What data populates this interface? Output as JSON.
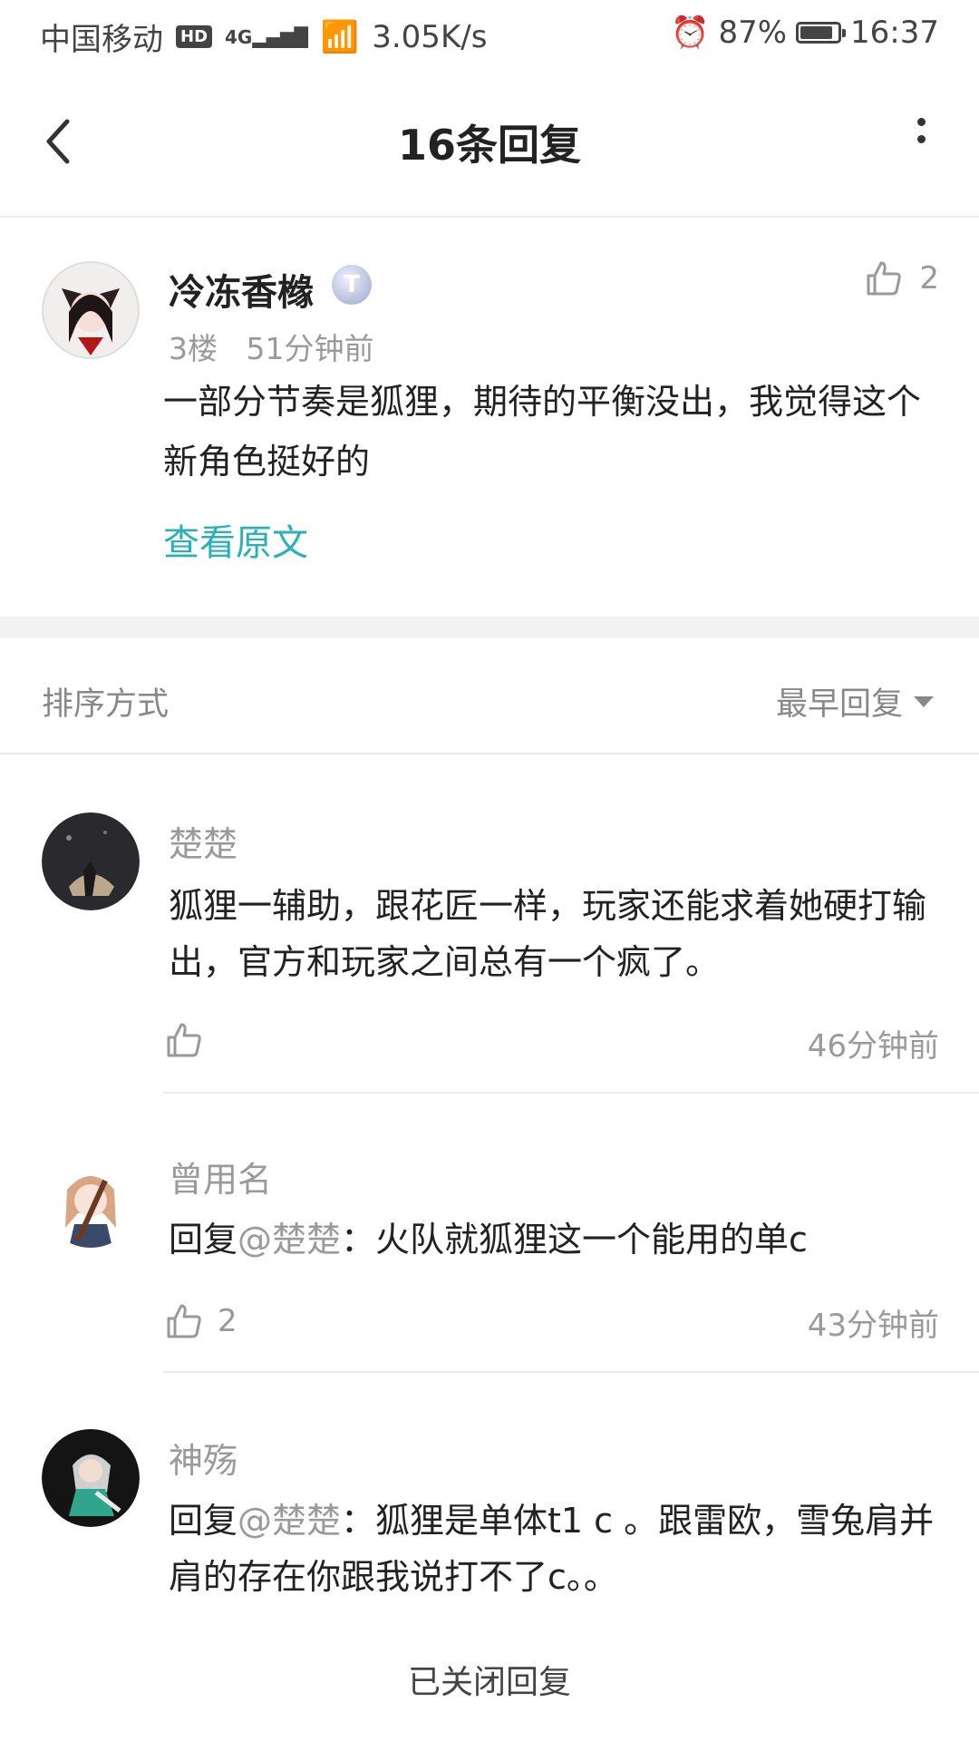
{
  "status_bar": {
    "carrier": "中国移动",
    "hd": "HD",
    "signal": "4G",
    "speed": "3.05K/s",
    "battery": "87%",
    "battery_level": 0.87,
    "time": "16:37"
  },
  "header": {
    "title": "16条回复",
    "back_icon": "chevron-left-icon",
    "more_icon": "more-vertical-icon"
  },
  "main_comment": {
    "username": "冷冻香橼",
    "badge": "T",
    "floor": "3楼",
    "time": "51分钟前",
    "text": "一部分节奏是狐狸，期待的平衡没出，我觉得这个新角色挺好的",
    "view_original": "查看原文",
    "likes": "2"
  },
  "sort": {
    "label": "排序方式",
    "value": "最早回复"
  },
  "replies": [
    {
      "username": "楚楚",
      "prefix": "",
      "mention": "",
      "text": "狐狸一辅助，跟花匠一样，玩家还能求着她硬打输出，官方和玩家之间总有一个疯了。",
      "likes": "",
      "time": "46分钟前"
    },
    {
      "username": "曾用名",
      "prefix": "回复",
      "mention": "@楚楚",
      "text": "：火队就狐狸这一个能用的单c",
      "likes": "2",
      "time": "43分钟前"
    },
    {
      "username": "神殇",
      "prefix": "回复",
      "mention": "@楚楚",
      "text": "：狐狸是单体t1 c 。跟雷欧，雪兔肩并肩的存在你跟我说打不了c。。",
      "likes": "",
      "time": ""
    }
  ],
  "footer": {
    "closed": "已关闭回复"
  },
  "colors": {
    "accent": "#29b1b8",
    "muted": "#9a9a9a",
    "text": "#222222"
  }
}
